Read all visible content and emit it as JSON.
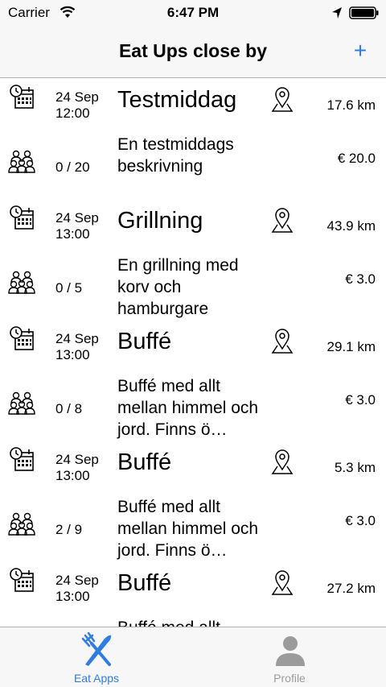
{
  "status_bar": {
    "carrier": "Carrier",
    "time": "6:47 PM"
  },
  "nav": {
    "title": "Eat Ups close by",
    "add_label": "+"
  },
  "events": [
    {
      "date": "24 Sep",
      "time": "12:00",
      "title": "Testmiddag",
      "distance": "17.6 km",
      "description": "En testmiddags beskrivning",
      "seats": "0 / 20",
      "price": "€ 20.0"
    },
    {
      "date": "24 Sep",
      "time": "13:00",
      "title": "Grillning",
      "distance": "43.9 km",
      "description": "En grillning med korv och hamburgare",
      "seats": "0 / 5",
      "price": "€ 3.0"
    },
    {
      "date": "24 Sep",
      "time": "13:00",
      "title": "Buffé",
      "distance": "29.1 km",
      "description": "Buffé med allt mellan himmel och jord. Finns ö…",
      "seats": "0 / 8",
      "price": "€ 3.0"
    },
    {
      "date": "24 Sep",
      "time": "13:00",
      "title": "Buffé",
      "distance": "5.3 km",
      "description": "Buffé med allt mellan himmel och jord. Finns ö…",
      "seats": "2 / 9",
      "price": "€ 3.0"
    },
    {
      "date": "24 Sep",
      "time": "13:00",
      "title": "Buffé",
      "distance": "27.2 km",
      "description": "Buffé med allt",
      "seats": "",
      "price": ""
    }
  ],
  "tabs": [
    {
      "label": "Eat Apps",
      "icon": "fork-knife-icon",
      "selected": true
    },
    {
      "label": "Profile",
      "icon": "profile-icon",
      "selected": false
    }
  ],
  "colors": {
    "accent": "#2f7de1",
    "inactive": "#9b9b9b",
    "bar_background": "#f7f7f7"
  }
}
